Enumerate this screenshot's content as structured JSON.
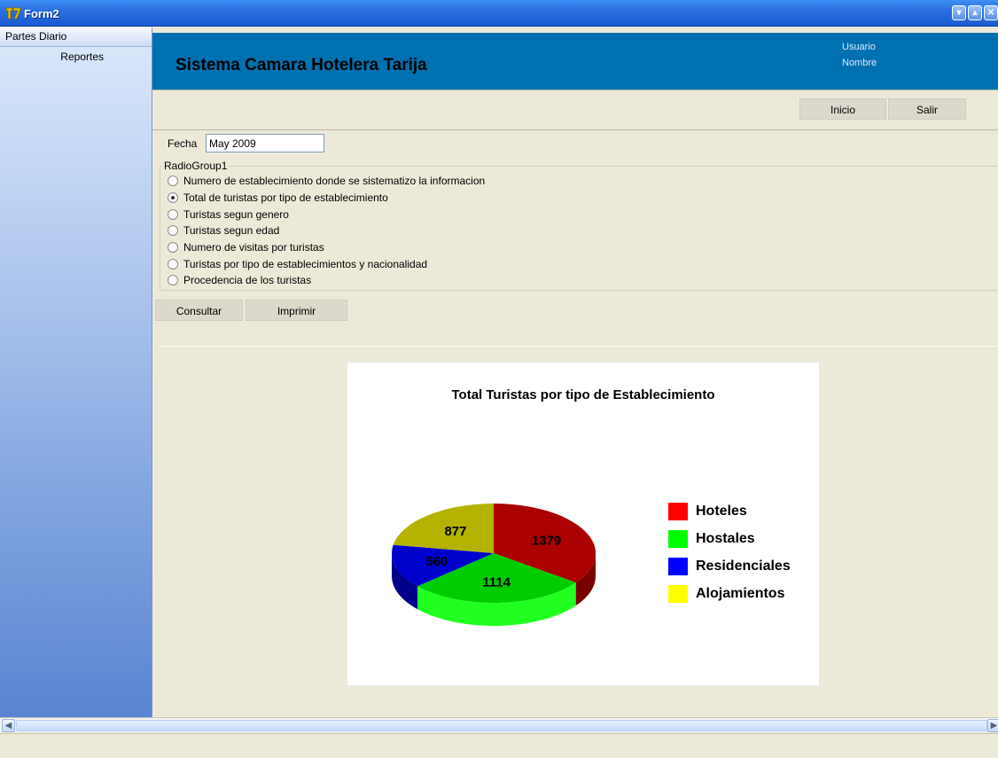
{
  "window": {
    "title": "Form2"
  },
  "sidebar": {
    "header": "Partes Diario",
    "items": [
      {
        "label": "Reportes"
      }
    ]
  },
  "banner": {
    "title": "Sistema Camara Hotelera Tarija",
    "user_label": "Usuario",
    "name_label": "Nombre"
  },
  "toolbar": {
    "inicio_label": "Inicio",
    "salir_label": "Salir"
  },
  "fecha": {
    "label": "Fecha",
    "value": "May 2009"
  },
  "radiogroup": {
    "legend": "RadioGroup1",
    "options": [
      {
        "label": "Numero de establecimiento donde se sistematizo la informacion",
        "checked": false
      },
      {
        "label": "Total de turistas por tipo de establecimiento",
        "checked": true
      },
      {
        "label": "Turistas segun genero",
        "checked": false
      },
      {
        "label": "Turistas segun edad",
        "checked": false
      },
      {
        "label": "Numero de visitas por turistas",
        "checked": false
      },
      {
        "label": "Turistas por tipo de establecimientos y nacionalidad",
        "checked": false
      },
      {
        "label": "Procedencia de los turistas",
        "checked": false
      }
    ]
  },
  "actions": {
    "consultar_label": "Consultar",
    "imprimir_label": "Imprimir"
  },
  "chart_data": {
    "type": "pie",
    "title": "Total Turistas por tipo de Establecimiento",
    "categories": [
      "Hoteles",
      "Hostales",
      "Residenciales",
      "Alojamientos"
    ],
    "values": [
      1379,
      1114,
      560,
      877
    ],
    "colors": [
      "#aa0000",
      "#00cc00",
      "#0000cc",
      "#b3b300"
    ],
    "side_colors": [
      "#7a0000",
      "#20ff20",
      "#00008a",
      "#8a8a00"
    ],
    "legend_colors": [
      "#ff0000",
      "#00ff00",
      "#0000ff",
      "#ffff00"
    ],
    "three_d": true,
    "legend_position": "right"
  },
  "colors": {
    "banner": "#0071b0",
    "titlebar": "#2a6fe0"
  }
}
